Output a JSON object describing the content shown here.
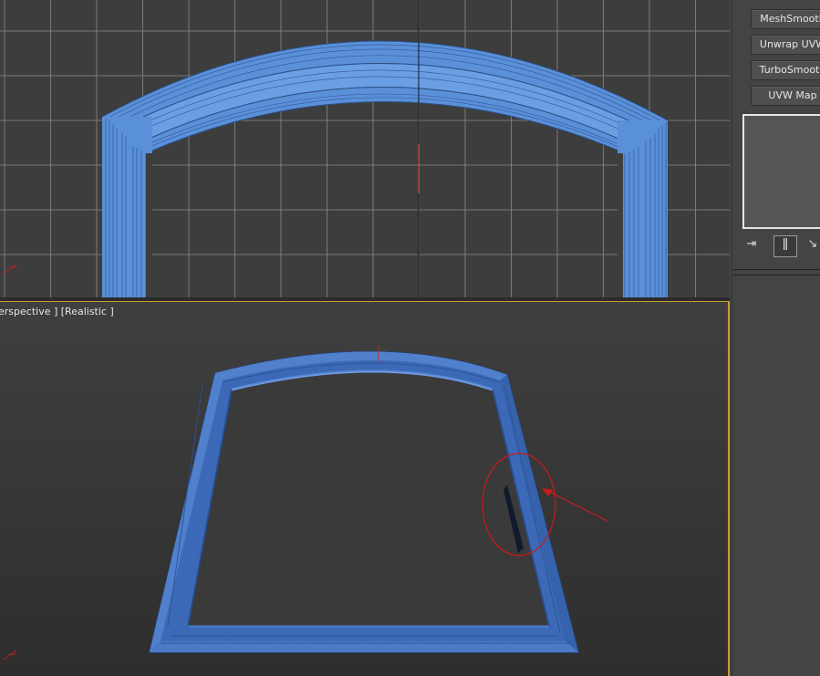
{
  "top_viewport": {
    "name": "front-viewport",
    "mesh_color": "#5a90d8",
    "grid_color": "#8a8a8a"
  },
  "bottom_viewport": {
    "label_parts": [
      "erspective ]",
      "[Realistic ]"
    ],
    "mesh_color": "#3f6fc0",
    "highlight_border_color": "#c8a030",
    "annotation_color": "#d01818"
  },
  "modifier_buttons": [
    {
      "label": "MeshSmooth"
    },
    {
      "label": "Unwrap UVW"
    },
    {
      "label": "TurboSmooth"
    },
    {
      "label": "UVW Map"
    }
  ],
  "modifier_stack_tools": [
    {
      "icon": "pin-stack-icon",
      "glyph": "⇥"
    },
    {
      "icon": "show-end-result-icon",
      "glyph": "ǁ"
    },
    {
      "icon": "make-unique-icon",
      "glyph": "↘"
    }
  ]
}
